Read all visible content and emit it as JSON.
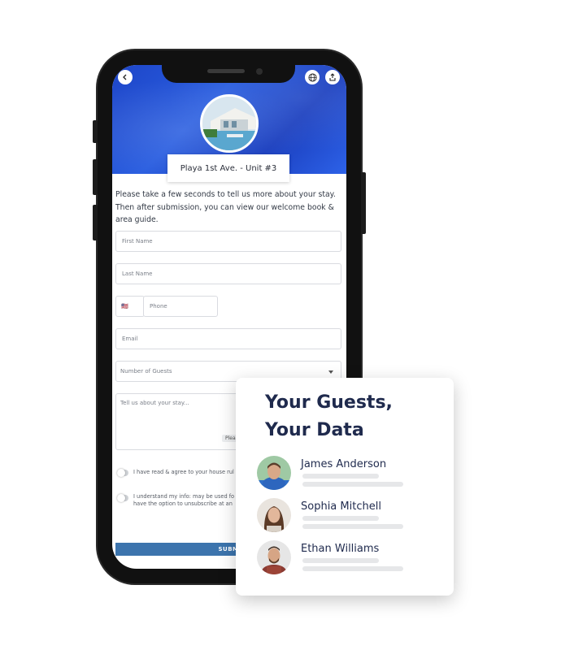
{
  "phone": {
    "property_title": "Playa 1st Ave. - Unit #3",
    "intro_text": "Please take a few seconds to tell us more about your stay. Then after submission, you can view our welcome book & area guide.",
    "fields": {
      "first_name": "First Name",
      "last_name": "Last Name",
      "phone_flag": "🇺🇸",
      "phone": "Phone",
      "email": "Email",
      "guests": "Number of Guests",
      "stay": "Tell us about your stay...",
      "stay_hint": "Please"
    },
    "consent": {
      "house_rules": "I have read & agree to your house rul",
      "marketing_line1": "I understand my info: may be used fo",
      "marketing_line2": "have the option to unsubscribe at an"
    },
    "submit_label": "SUBM",
    "icons": {
      "back": "back-arrow-icon",
      "globe": "globe-icon",
      "share": "share-icon"
    },
    "colors": {
      "hero_blue": "#2a5ee0",
      "submit": "#3c74ad"
    }
  },
  "card": {
    "title_line1": "Your Guests,",
    "title_line2": "Your Data",
    "guests": [
      {
        "name": "James Anderson"
      },
      {
        "name": "Sophia Mitchell"
      },
      {
        "name": "Ethan Williams"
      }
    ],
    "colors": {
      "title": "#1f2a4d"
    }
  }
}
